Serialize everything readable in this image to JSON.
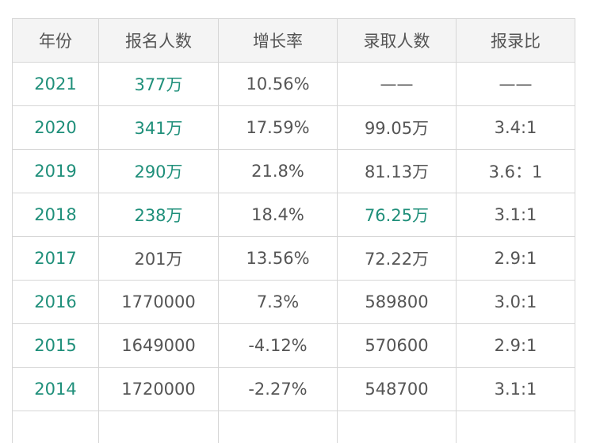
{
  "colors": {
    "accent_teal": "#1f8f7a",
    "text_gray": "#555555",
    "header_bg": "#f4f4f4",
    "border": "#d6d6d6"
  },
  "table": {
    "headers": [
      "年份",
      "报名人数",
      "增长率",
      "录取人数",
      "报录比"
    ],
    "rows": [
      [
        "2021",
        "377万",
        "10.56%",
        "——",
        "——"
      ],
      [
        "2020",
        "341万",
        "17.59%",
        "99.05万",
        "3.4:1"
      ],
      [
        "2019",
        "290万",
        "21.8%",
        "81.13万",
        "3.6：1"
      ],
      [
        "2018",
        "238万",
        "18.4%",
        "76.25万",
        "3.1:1"
      ],
      [
        "2017",
        "201万",
        "13.56%",
        "72.22万",
        "2.9:1"
      ],
      [
        "2016",
        "1770000",
        "7.3%",
        "589800",
        "3.0:1"
      ],
      [
        "2015",
        "1649000",
        "-4.12%",
        "570600",
        "2.9:1"
      ],
      [
        "2014",
        "1720000",
        "-2.27%",
        "548700",
        "3.1:1"
      ]
    ]
  }
}
